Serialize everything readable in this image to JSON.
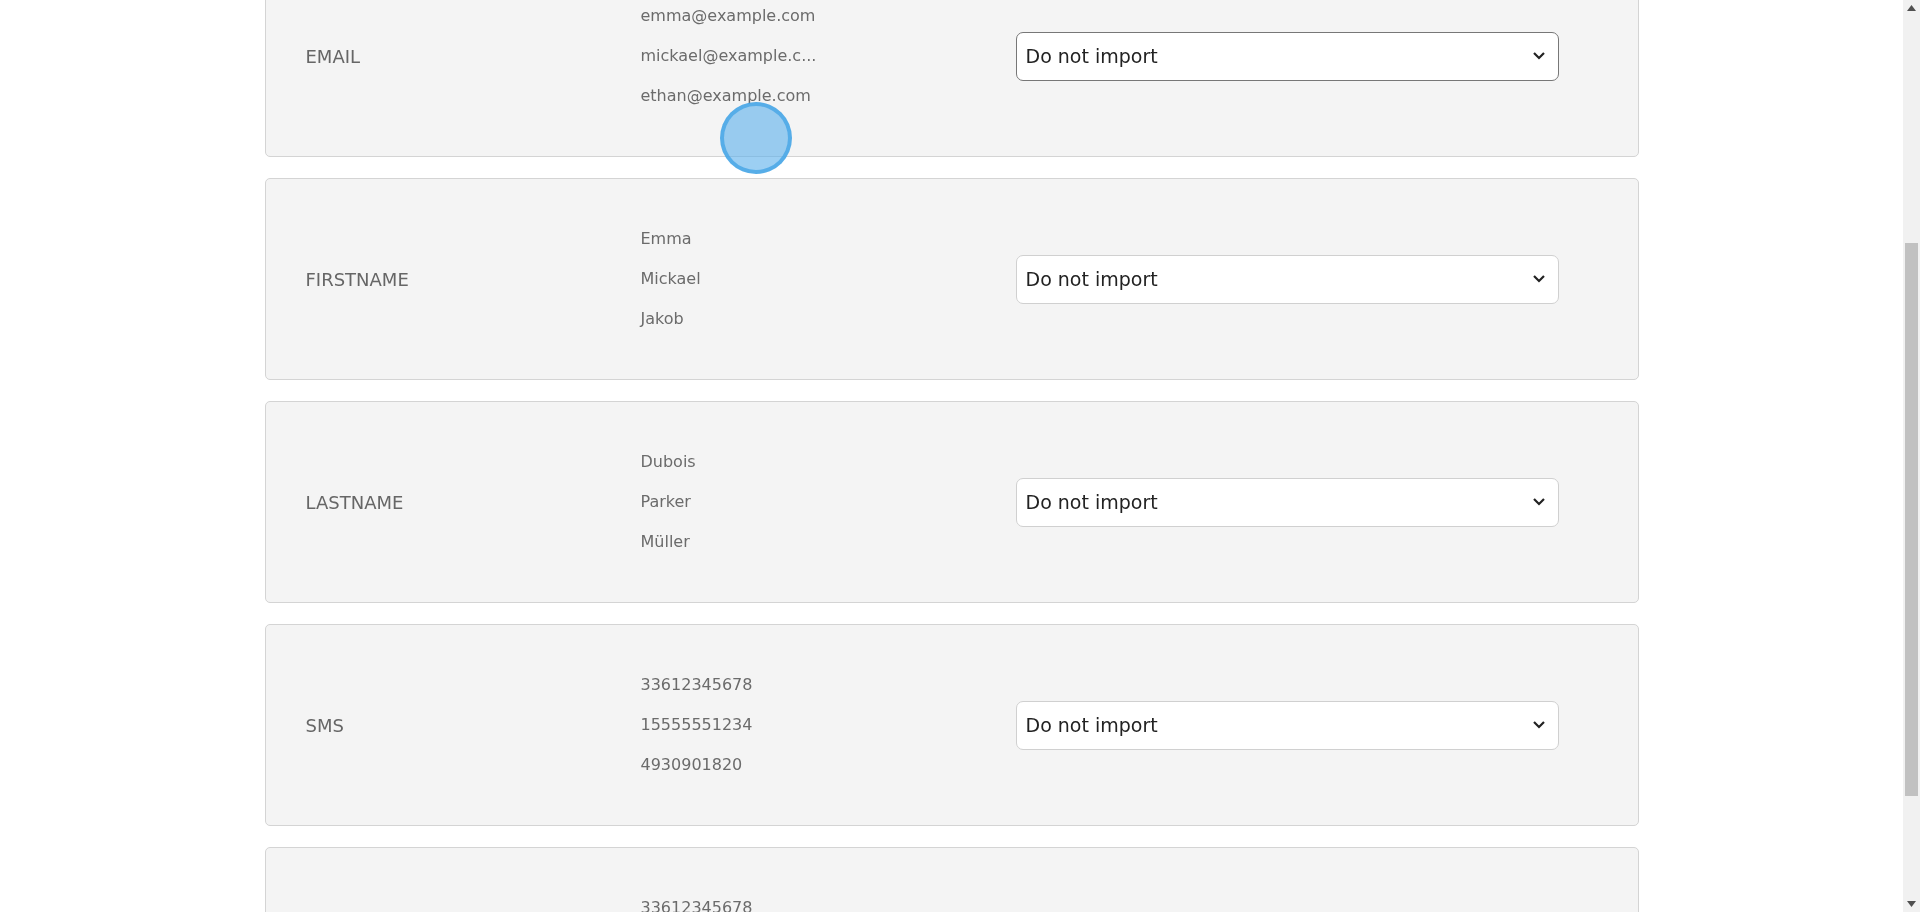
{
  "fields": [
    {
      "label": "EMAIL",
      "values": [
        "emma@example.com",
        "mickael@example.c...",
        "ethan@example.com"
      ],
      "select": {
        "value": "Do not import",
        "focused": true
      }
    },
    {
      "label": "FIRSTNAME",
      "values": [
        "Emma",
        "Mickael",
        "Jakob"
      ],
      "select": {
        "value": "Do not import",
        "focused": false
      }
    },
    {
      "label": "LASTNAME",
      "values": [
        "Dubois",
        "Parker",
        "Müller"
      ],
      "select": {
        "value": "Do not import",
        "focused": false
      }
    },
    {
      "label": "SMS",
      "values": [
        "33612345678",
        "15555551234",
        "4930901820"
      ],
      "select": {
        "value": "Do not import",
        "focused": false
      }
    },
    {
      "values": [
        "33612345678"
      ]
    }
  ]
}
